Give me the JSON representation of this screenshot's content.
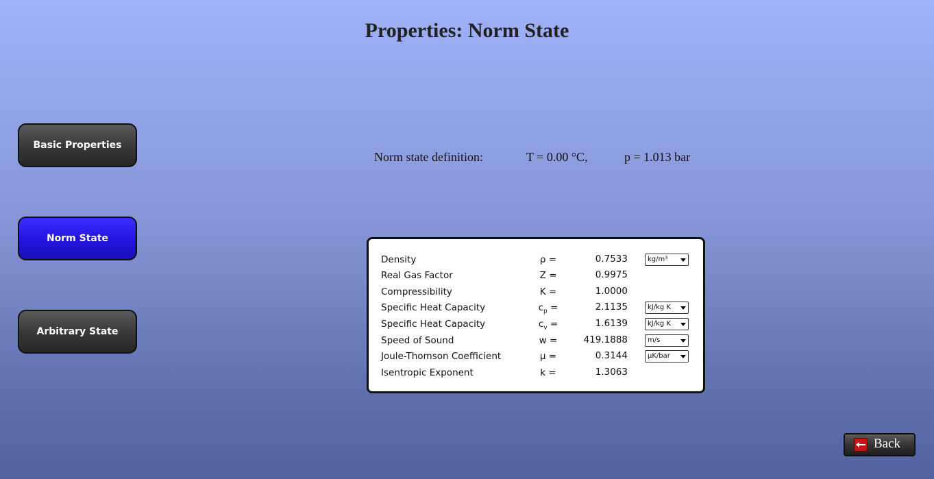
{
  "page": {
    "title": "Properties: Norm State"
  },
  "nav": {
    "basic_label": "Basic Properties",
    "norm_label": "Norm State",
    "arbitrary_label": "Arbitrary State",
    "active": "Norm State"
  },
  "norm_definition": {
    "label": "Norm state definition:",
    "temperature": "T = 0.00 °C,",
    "pressure": "p = 1.013 bar"
  },
  "properties": [
    {
      "name": "Density",
      "symbol": "ρ =",
      "value": "0.7533",
      "unit": "kg/m³"
    },
    {
      "name": "Real Gas Factor",
      "symbol": "Z =",
      "value": "0.9975",
      "unit": ""
    },
    {
      "name": "Compressibility",
      "symbol": "K =",
      "value": "1.0000",
      "unit": ""
    },
    {
      "name": "Specific Heat Capacity",
      "symbol": "c",
      "symbol_sub": "p",
      "symbol_suffix": " =",
      "value": "2.1135",
      "unit": "kJ/kg K"
    },
    {
      "name": "Specific Heat Capacity",
      "symbol": "c",
      "symbol_sub": "v",
      "symbol_suffix": " =",
      "value": "1.6139",
      "unit": "kJ/kg K"
    },
    {
      "name": "Speed of Sound",
      "symbol": "w =",
      "value": "419.1888",
      "unit": "m/s"
    },
    {
      "name": "Joule-Thomson Coefficient",
      "symbol": "μ =",
      "value": "0.3144",
      "unit": "μK/bar"
    },
    {
      "name": "Isentropic Exponent",
      "symbol": "k =",
      "value": "1.3063",
      "unit": ""
    }
  ],
  "footer": {
    "back_label": "Back"
  },
  "colors": {
    "active_button": "#2415e0",
    "inactive_button": "#3a3a3a",
    "back_icon": "#c81414"
  }
}
